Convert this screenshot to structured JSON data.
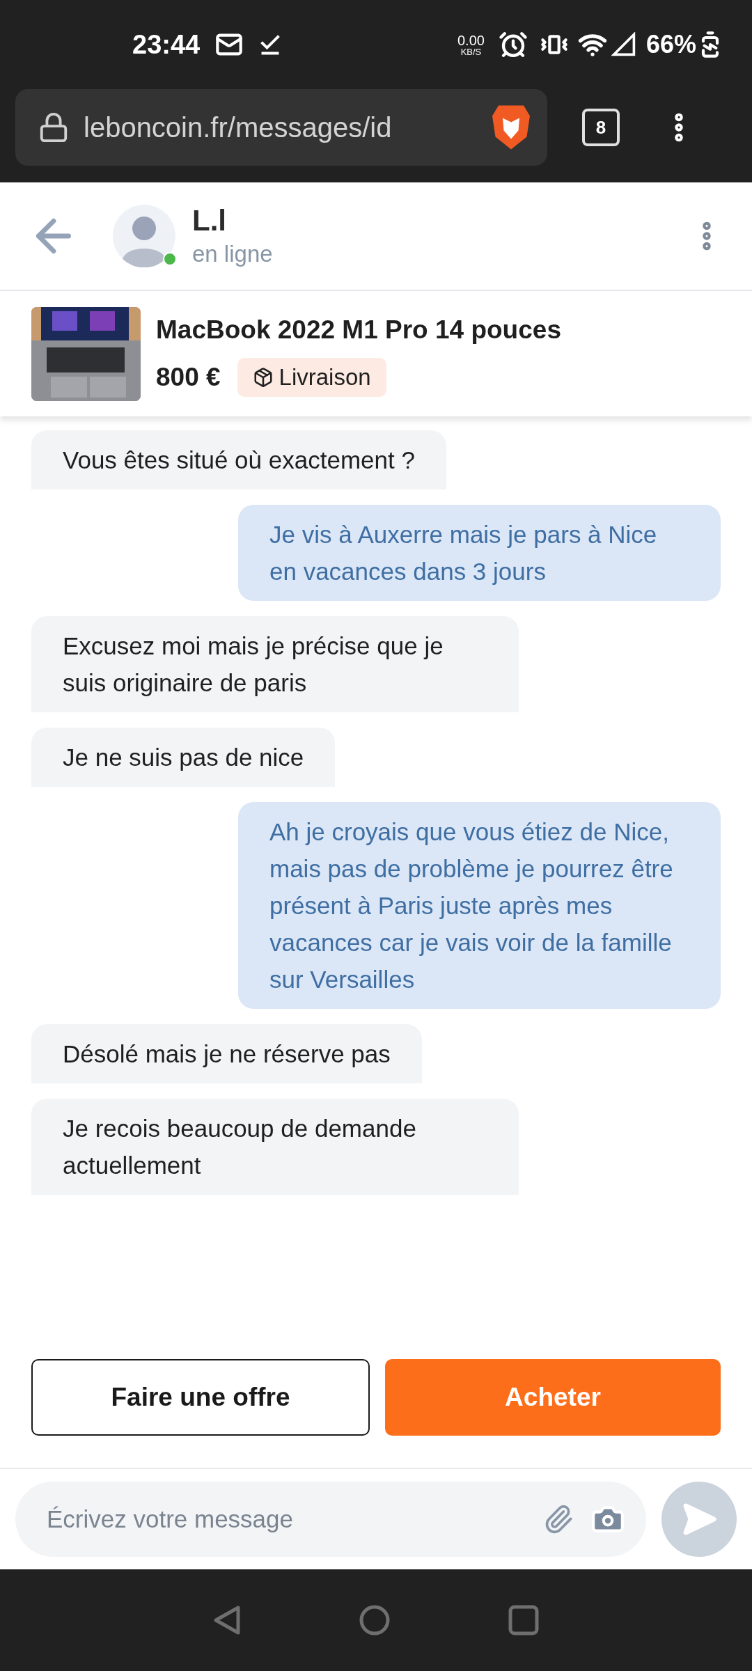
{
  "status_bar": {
    "time": "23:44",
    "net_speed": "0.00",
    "net_unit": "KB/S",
    "battery": "66%"
  },
  "browser": {
    "url": "leboncoin.fr/messages/id",
    "tab_count": "8"
  },
  "header": {
    "name": "L.l",
    "status": "en ligne",
    "online": true
  },
  "listing": {
    "title": "MacBook 2022 M1 Pro 14 pouces",
    "price": "800 €",
    "badge": "Livraison"
  },
  "messages": [
    {
      "kind": "received",
      "text": "Vous êtes situé où exactement ?"
    },
    {
      "kind": "sent",
      "text": "Je vis à Auxerre mais je pars à Nice en vacances dans 3 jours"
    },
    {
      "kind": "received",
      "text": "Excusez moi mais je précise que je suis originaire de paris"
    },
    {
      "kind": "received",
      "text": "Je ne suis pas de nice"
    },
    {
      "kind": "sent",
      "text": "Ah je croyais que vous étiez de Nice, mais pas de problème je pourrez être présent à Paris juste après mes vacances car je vais voir de la famille sur Versailles"
    },
    {
      "kind": "received",
      "text": "Désolé mais je ne réserve pas"
    },
    {
      "kind": "received",
      "text": "Je recois beaucoup de demande actuellement"
    }
  ],
  "actions": {
    "offer": "Faire une offre",
    "buy": "Acheter"
  },
  "composer": {
    "placeholder": "Écrivez votre message"
  }
}
